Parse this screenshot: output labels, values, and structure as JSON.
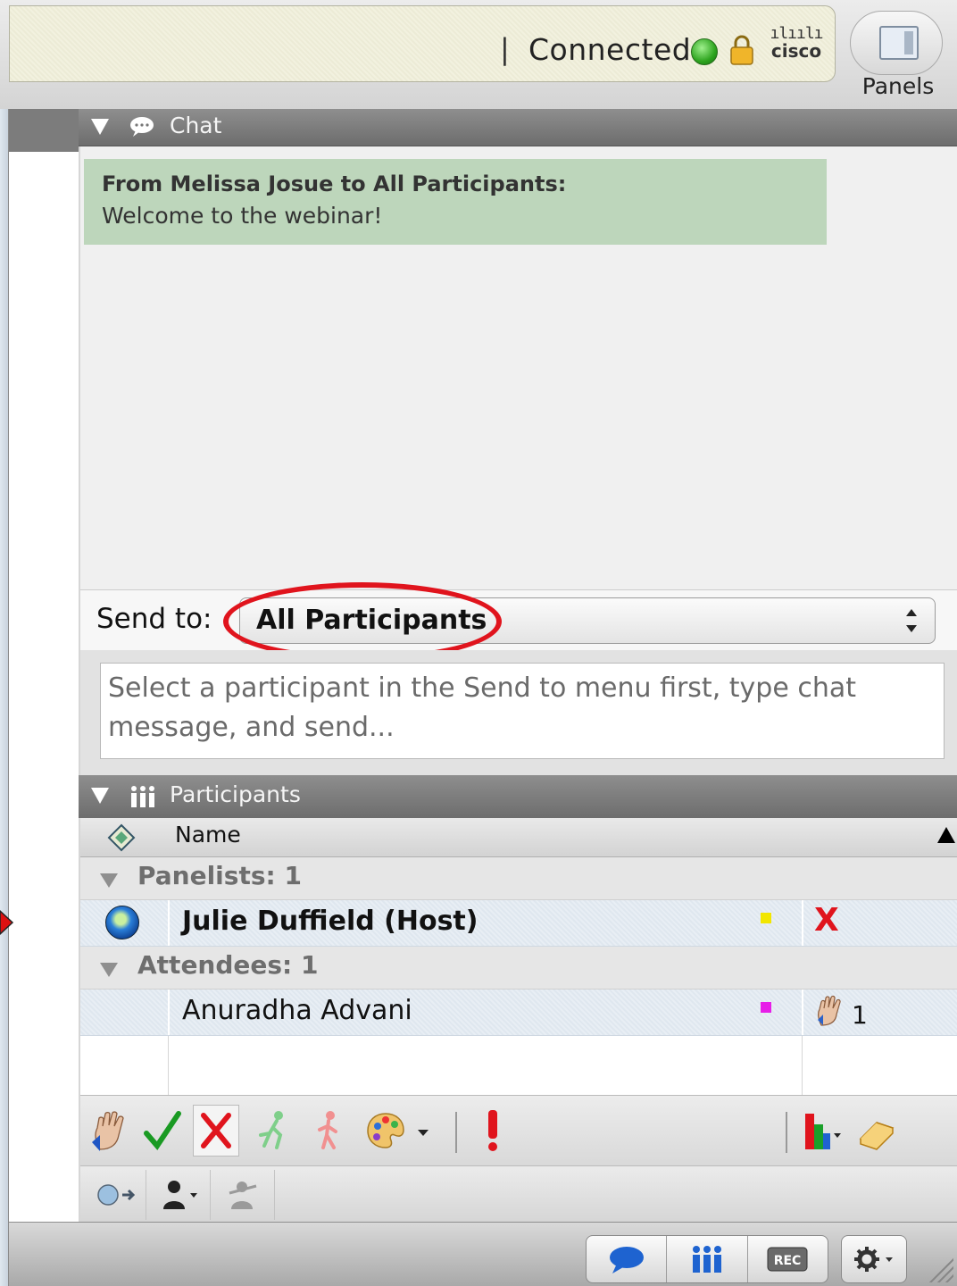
{
  "status": {
    "separator": "|",
    "connection_text": "Connected",
    "connection_color": "#2ea41f",
    "brand": {
      "bars": "ılıılı",
      "word": "cisco"
    }
  },
  "panels_button": {
    "label": "Panels"
  },
  "chat": {
    "title": "Chat",
    "message": {
      "from": "From Melissa Josue to All Participants:",
      "text": "Welcome to the webinar!"
    },
    "send_to_label": "Send to:",
    "send_to_value": "All Participants",
    "input_placeholder": "Select a participant in the Send to menu first, type chat message, and send...",
    "highlight_color": "#e0141d"
  },
  "participants": {
    "title": "Participants",
    "column_name": "Name",
    "groups": [
      {
        "label": "Panelists: 1",
        "members": [
          {
            "name": "Julie Duffield (Host)",
            "color": "#f2e600",
            "status_icon": "x-icon"
          }
        ]
      },
      {
        "label": "Attendees: 1",
        "members": [
          {
            "name": "Anuradha Advani",
            "color": "#e71ee8",
            "status_icon": "raised-hand-icon",
            "status_count": "1"
          }
        ]
      }
    ]
  },
  "toolbar": {
    "icons": [
      "raise-hand-icon",
      "check-icon",
      "x-icon",
      "go-faster-icon",
      "go-slower-icon",
      "palette-icon",
      "dropdown-icon",
      "exclamation-icon",
      "chart-icon",
      "eraser-icon"
    ]
  },
  "toolbar2": {
    "icons": [
      "globe-arrow-icon",
      "person-menu-icon",
      "pass-presenter-icon"
    ]
  },
  "bottom_bar": {
    "buttons": [
      "chat-bubble-icon",
      "participants-icon",
      "rec-icon"
    ],
    "rec_label": "REC",
    "gear": "gear-icon"
  }
}
